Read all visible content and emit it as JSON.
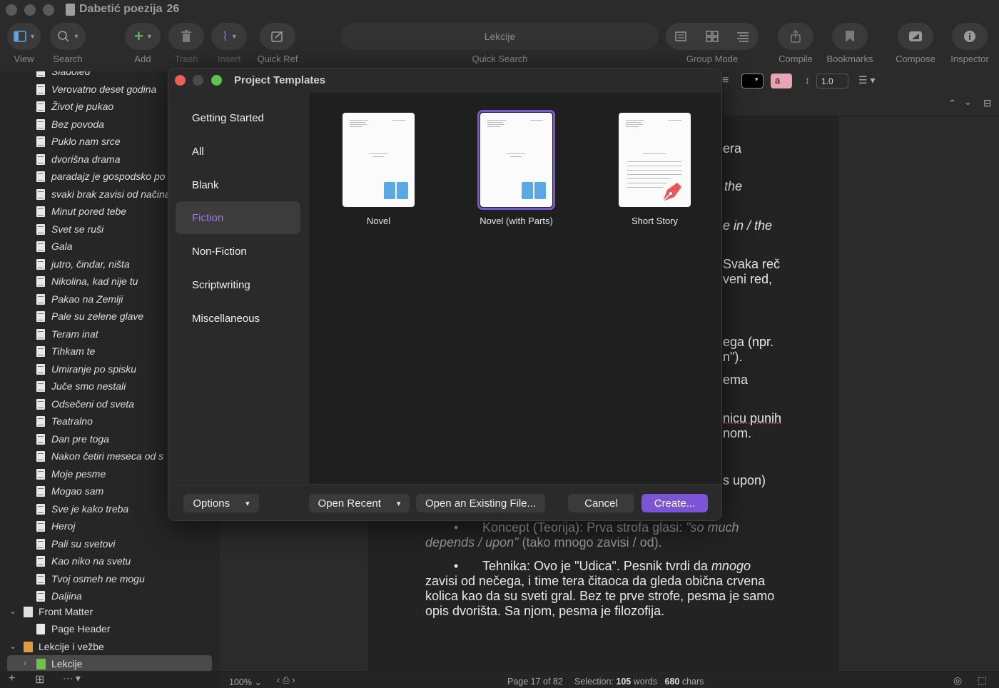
{
  "app": {
    "title": "Dabetić poezija",
    "title_number": "26"
  },
  "toolbar": {
    "view_label": "View",
    "search_label": "Search",
    "add_label": "Add",
    "trash_label": "Trash",
    "insert_label": "Insert",
    "quickref_label": "Quick Ref",
    "quick_search_text": "Lekcije",
    "quick_search_label": "Quick Search",
    "group_mode_label": "Group Mode",
    "compile_label": "Compile",
    "bookmarks_label": "Bookmarks",
    "compose_label": "Compose",
    "inspector_label": "Inspector"
  },
  "binder": {
    "items": [
      "Sladoled",
      "Verovatno deset godina",
      "Život je pukao",
      "Bez povoda",
      "Puklo nam srce",
      "dvorišna drama",
      "paradajz je gospodsko po",
      "svaki brak zavisi od načina",
      "Minut pored tebe",
      "Svet se ruši",
      "Gala",
      "jutro, čindar, ništa",
      "Nikolina, kad nije tu",
      "Pakao na Zemlji",
      "Pale su zelene glave",
      "Teram inat",
      "Tihkam te",
      "Umiranje po spisku",
      "Juče smo nestali",
      "Odsečeni od sveta",
      "Teatralno",
      "Dan pre toga",
      "Nakon četiri meseca od s",
      "Moje pesme",
      "Mogao sam",
      "Sve je kako treba",
      "Heroj",
      "Pali su svetovi",
      "Kao niko na svetu",
      "Tvoj osmeh ne mogu",
      "Daljina"
    ],
    "front_matter": "Front Matter",
    "page_header": "Page Header",
    "lekcije_folder": "Lekcije i vežbe",
    "lekcije_selected": "Lekcije"
  },
  "format_bar": {
    "line_spacing": "1.0",
    "highlight_letter": "a"
  },
  "editor": {
    "fragments": [
      "era",
      "the",
      "e in / the",
      "Svaka reč",
      "veni red,",
      "ega (npr.",
      "n\").",
      "ema",
      "nicu punih",
      "nom.",
      "s upon)"
    ],
    "bullet1_prefix": "Koncept (Teorija): Prva strofa glasi: ",
    "bullet1_italic": "\"so much",
    "bullet1_line2_italic": "depends / upon\"",
    "bullet1_line2_rest": " (tako mnogo zavisi / od).",
    "bullet2_prefix": "Tehnika: Ovo je \"Udica\". Pesnik tvrdi da ",
    "bullet2_italic": "mnogo",
    "bullet2_line2": "zavisi od nečega, i time tera čitaoca da gleda obična crvena",
    "bullet2_line3": "kolica kao da su sveti gral. Bez te prve strofe, pesma je samo",
    "bullet2_line4": "opis dvorišta. Sa njom, pesma je filozofija.",
    "bullet_glyph": "•"
  },
  "status": {
    "zoom": "100%",
    "page_info": "Page 17 of 82",
    "selection_label": "Selection:",
    "words_count": "105",
    "words_label": "words",
    "chars_count": "680",
    "chars_label": "chars"
  },
  "modal": {
    "title": "Project Templates",
    "categories": [
      "Getting Started",
      "All",
      "Blank",
      "Fiction",
      "Non-Fiction",
      "Scriptwriting",
      "Miscellaneous"
    ],
    "selected_category": "Fiction",
    "templates": [
      "Novel",
      "Novel (with Parts)",
      "Short Story"
    ],
    "options_label": "Options",
    "open_recent_label": "Open Recent",
    "open_existing_label": "Open an Existing File...",
    "cancel_label": "Cancel",
    "create_label": "Create..."
  },
  "colors": {
    "accent": "#7b55d6",
    "close": "#ed5f57",
    "minimize": "#4a4a4a",
    "zoom": "#5fc150",
    "book_icon": "#5aa9e6",
    "pen_icon": "#e8575a"
  }
}
